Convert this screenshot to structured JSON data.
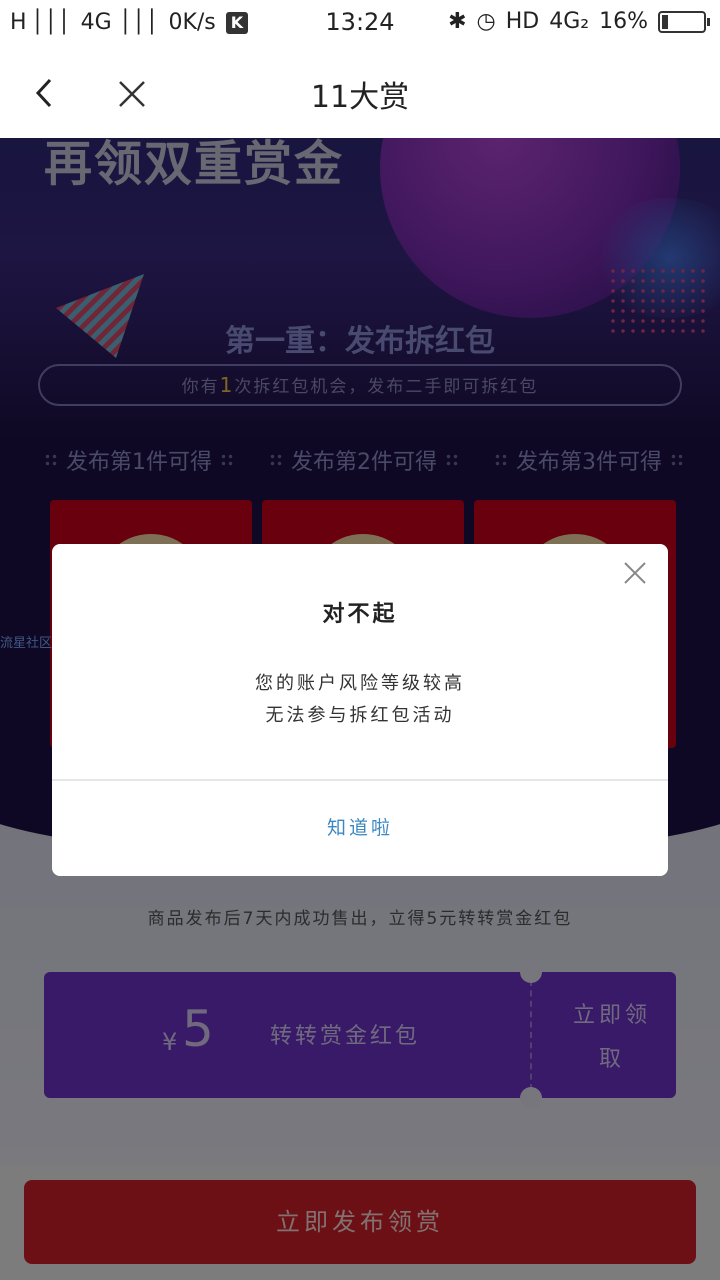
{
  "status_bar": {
    "signal": "H │││",
    "network": "4G │││",
    "speed": "0K/s",
    "k_badge": "K",
    "time": "13:24",
    "hd": "HD",
    "network2": "4G₂",
    "battery": "16%",
    "battery_level": 0.16
  },
  "navbar": {
    "title": "11大赏"
  },
  "page": {
    "headline": "再领双重赏金",
    "section_title": "第一重：发布拆红包",
    "pill_prefix": "你有",
    "pill_count": "1",
    "pill_suffix": "次拆红包机会，发布二手即可拆红包",
    "tiers": [
      "发布第1件可得",
      "发布第2件可得",
      "发布第3件可得"
    ],
    "side_label": "流星社区",
    "sale_line": "商品发布后7天内成功售出，立得5元转转赏金红包",
    "coupon": {
      "currency": "¥",
      "amount": "5",
      "label": "转转赏金红包",
      "claim_line1": "立即领",
      "claim_line2": "取"
    },
    "bottom_button": "立即发布领赏"
  },
  "dialog": {
    "title": "对不起",
    "line1": "您的账户风险等级较高",
    "line2": "无法参与拆红包活动",
    "button": "知道啦"
  }
}
